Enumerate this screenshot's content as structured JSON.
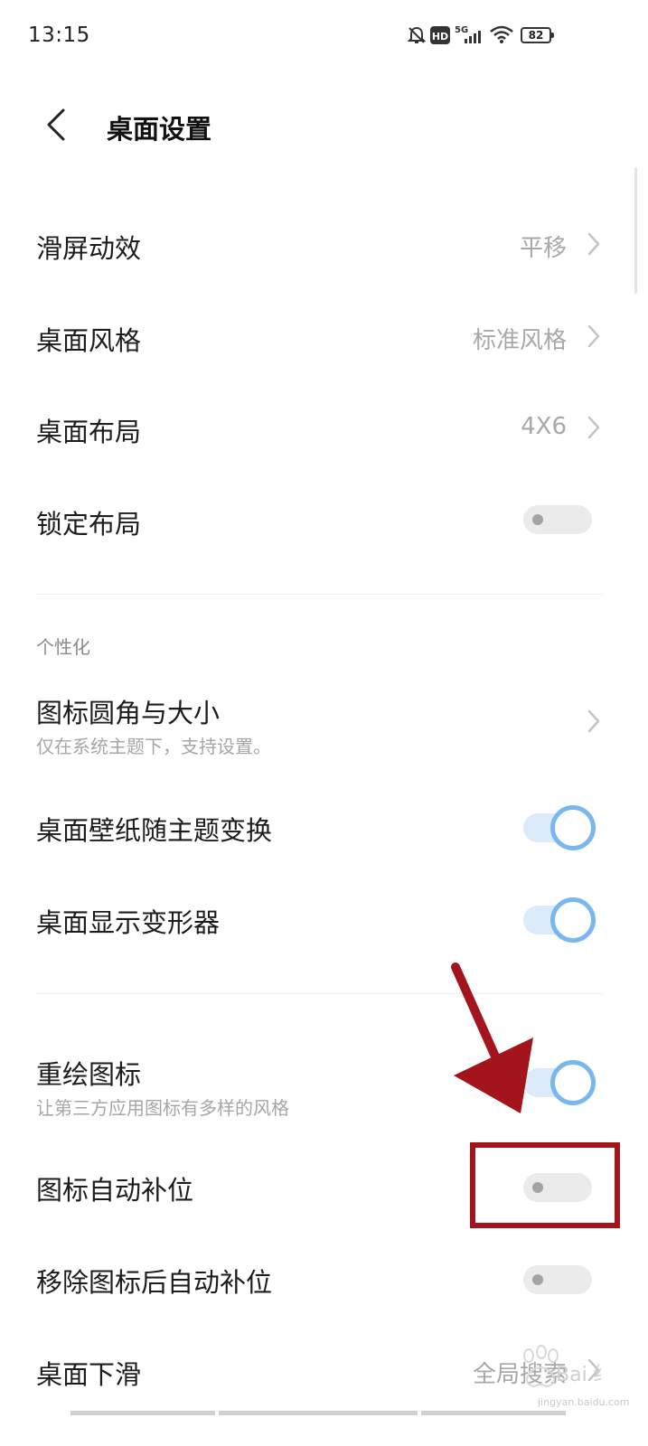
{
  "status_bar": {
    "time": "13:15",
    "battery_level": "82",
    "icons": [
      "mute-bell-icon",
      "hd-icon",
      "5g-signal-icon",
      "wifi-icon",
      "battery-icon"
    ]
  },
  "header": {
    "title": "桌面设置",
    "back_icon": "chevron-left-icon"
  },
  "settings": {
    "scroll_effect": {
      "label": "滑屏动效",
      "value": "平移"
    },
    "desktop_style": {
      "label": "桌面风格",
      "value": "标准风格"
    },
    "desktop_layout": {
      "label": "桌面布局",
      "value": "4X6"
    },
    "lock_layout": {
      "label": "锁定布局",
      "enabled": false
    },
    "personalization": {
      "header": "个性化",
      "icon_corner_size": {
        "label": "图标圆角与大小",
        "subtitle": "仅在系统主题下，支持设置。"
      },
      "wallpaper_follow_theme": {
        "label": "桌面壁纸随主题变换",
        "enabled": true
      },
      "show_transformer": {
        "label": "桌面显示变形器",
        "enabled": true
      }
    },
    "redraw_icons": {
      "label": "重绘图标",
      "subtitle": "让第三方应用图标有多样的风格",
      "enabled": true
    },
    "auto_fill_icons": {
      "label": "图标自动补位",
      "enabled": false
    },
    "auto_fill_after_remove": {
      "label": "移除图标后自动补位",
      "enabled": false
    },
    "desktop_swipe_down": {
      "label": "桌面下滑",
      "value": "全局搜索"
    }
  },
  "annotation": {
    "color": "#a4141d"
  },
  "watermark": {
    "brand": "Bai 经验",
    "url": "jingyan.baidu.com"
  },
  "colors": {
    "toggle_on_track": "#dcebfa",
    "toggle_on_ring": "#79b7ee",
    "toggle_off_track": "#ebebeb",
    "value_text": "#a8a8a8"
  }
}
